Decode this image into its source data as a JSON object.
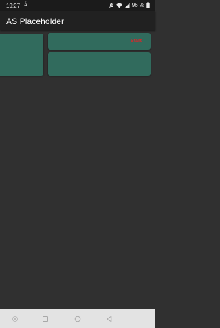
{
  "status_bar": {
    "time": "19:27",
    "indicator": "Á",
    "battery_percent": "96 %",
    "icons": [
      "mute-icon",
      "wifi-icon",
      "signal-icon",
      "battery-icon"
    ]
  },
  "app_bar": {
    "title": "AS Placeholder"
  },
  "cards": {
    "top_right": {
      "action_label": "Start"
    }
  },
  "colors": {
    "background": "#303030",
    "app_bar": "#212121",
    "card": "#316b5d",
    "action_text": "#d8282b",
    "nav_bar": "#e3e3e3"
  },
  "nav_bar": {
    "buttons": [
      "accessibility-icon",
      "recents-icon",
      "home-icon",
      "back-icon"
    ]
  }
}
